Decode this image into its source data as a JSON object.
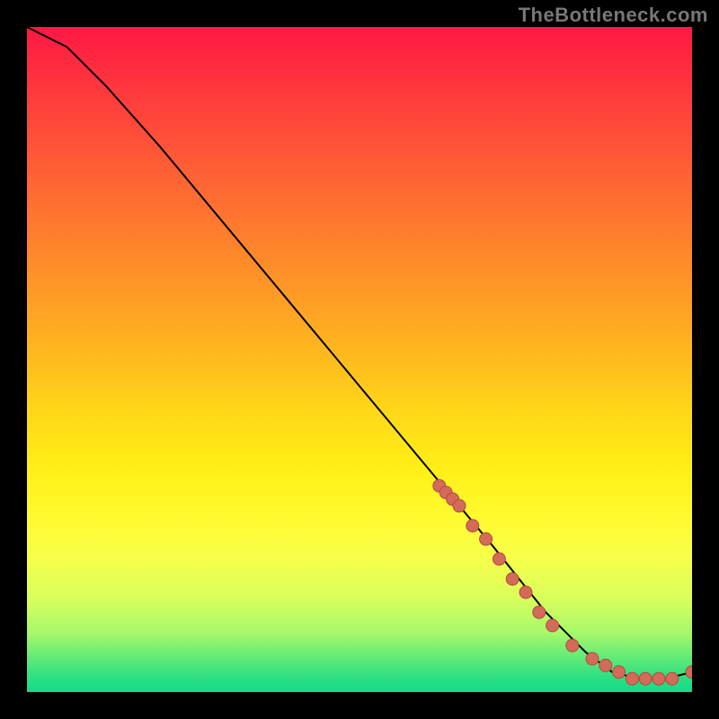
{
  "attribution": "TheBottleneck.com",
  "chart_data": {
    "type": "line",
    "title": "",
    "xlabel": "",
    "ylabel": "",
    "xlim": [
      0,
      100
    ],
    "ylim": [
      0,
      100
    ],
    "grid": false,
    "legend": false,
    "series": [
      {
        "name": "bottleneck-curve",
        "x": [
          0,
          6,
          12,
          20,
          30,
          40,
          50,
          60,
          70,
          78,
          84,
          88,
          92,
          96,
          100
        ],
        "y": [
          100,
          97,
          91,
          82,
          70,
          58,
          46,
          34,
          22,
          12,
          6,
          3,
          2,
          2,
          3
        ]
      }
    ],
    "markers": {
      "name": "highlighted-points",
      "x": [
        62,
        63,
        64,
        65,
        67,
        69,
        71,
        73,
        75,
        77,
        79,
        82,
        85,
        87,
        89,
        91,
        93,
        95,
        97,
        100
      ],
      "y": [
        31,
        30,
        29,
        28,
        25,
        23,
        20,
        17,
        15,
        12,
        10,
        7,
        5,
        4,
        3,
        2,
        2,
        2,
        2,
        3
      ]
    },
    "gradient_stops": [
      {
        "pos": 0,
        "color": "#ff1744"
      },
      {
        "pos": 50,
        "color": "#ffbb1e"
      },
      {
        "pos": 80,
        "color": "#f6ff4a"
      },
      {
        "pos": 100,
        "color": "#18d98a"
      }
    ]
  }
}
